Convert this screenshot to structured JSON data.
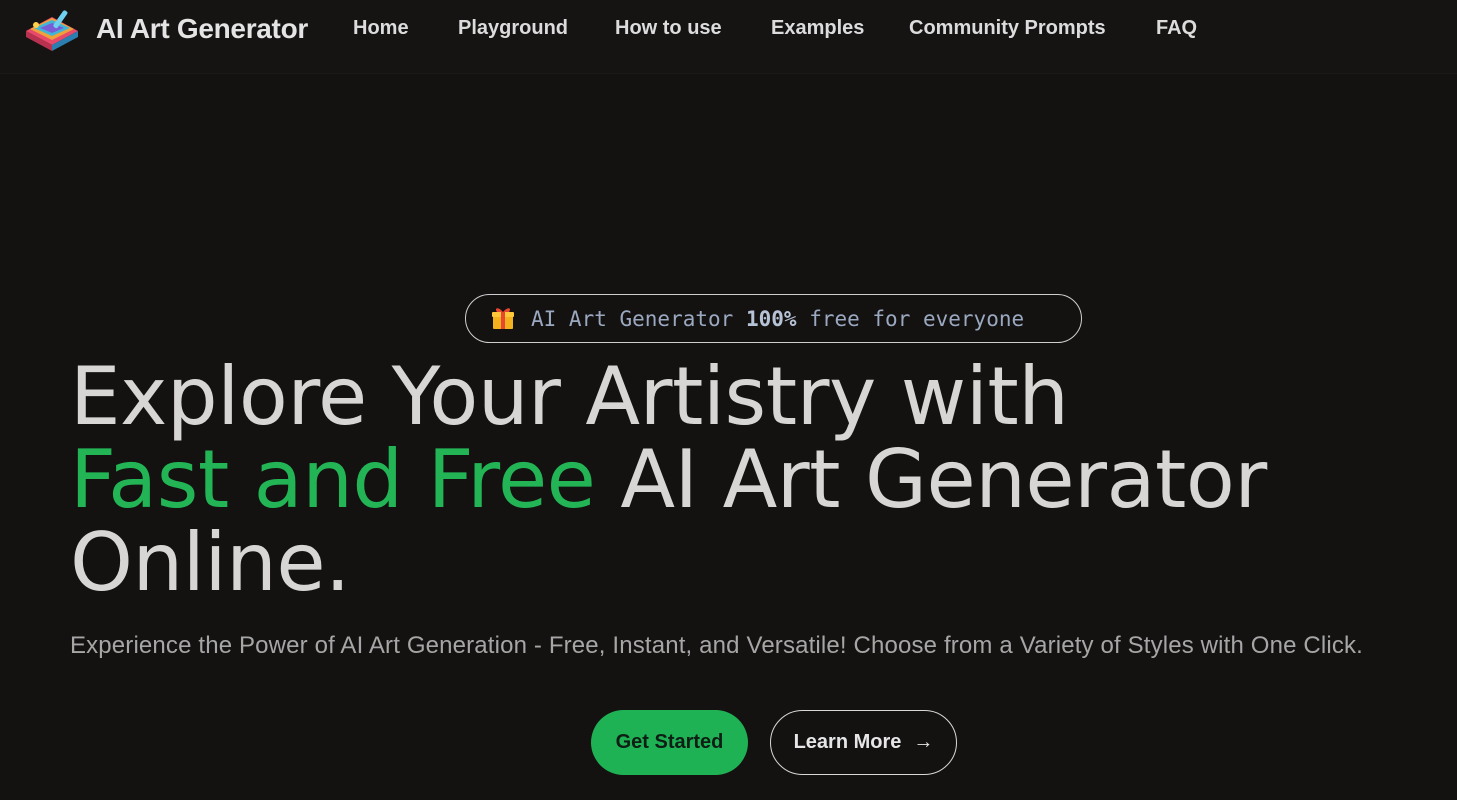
{
  "navbar": {
    "brand": "AI Art Generator",
    "links": [
      "Home",
      "Playground",
      "How to use",
      "Examples",
      "Community Prompts",
      "FAQ"
    ]
  },
  "hero": {
    "badge": {
      "icon": "gift-icon",
      "text_before": "AI Art Generator",
      "text_bold": "100%",
      "text_after": "free for everyone"
    },
    "headline": {
      "line1": "Explore Your Artistry with",
      "accent": "Fast and Free",
      "line2_rest": "AI Art Generator",
      "line3": "Online."
    },
    "subtitle": "Experience the Power of AI Art Generation - Free, Instant, and Versatile! Choose from a Variety of Styles with One Click.",
    "buttons": {
      "primary": "Get Started",
      "secondary": "Learn More",
      "secondary_icon": "arrow-right-icon"
    }
  },
  "colors": {
    "background": "#141111",
    "accent": "#22b455",
    "text": "#d8d6d4"
  }
}
